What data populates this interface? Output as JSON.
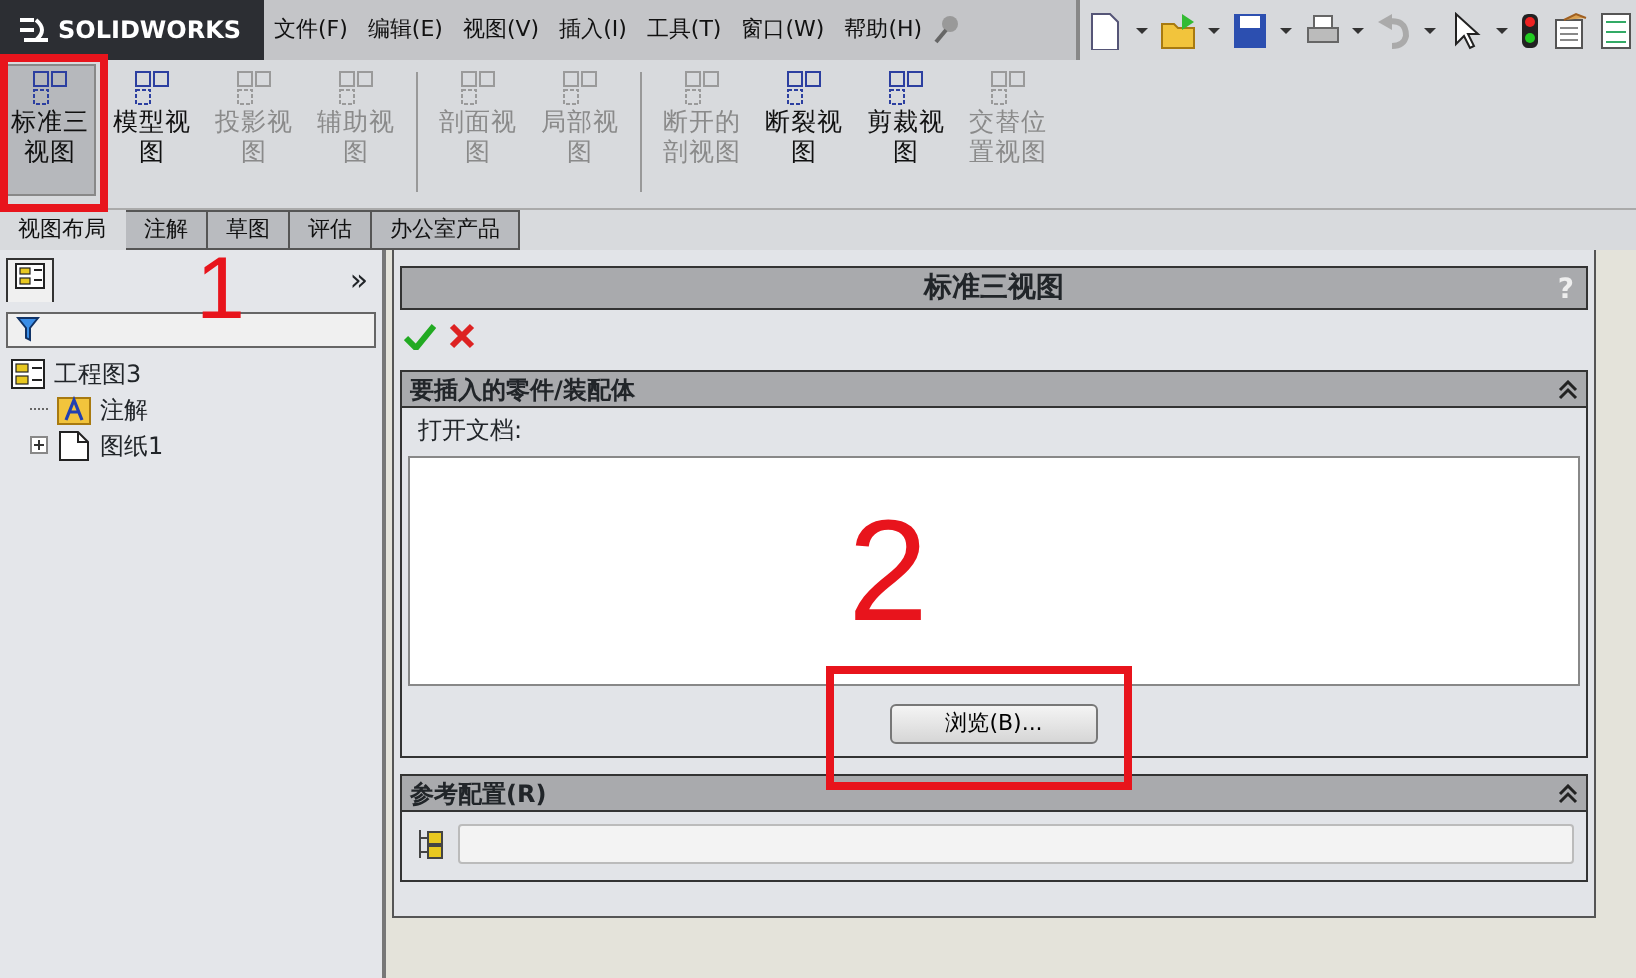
{
  "app": {
    "logo": "SOLIDWORKS"
  },
  "menu": [
    {
      "label": "文件(F)"
    },
    {
      "label": "编辑(E)"
    },
    {
      "label": "视图(V)"
    },
    {
      "label": "插入(I)"
    },
    {
      "label": "工具(T)"
    },
    {
      "label": "窗口(W)"
    },
    {
      "label": "帮助(H)"
    }
  ],
  "ribbon": [
    {
      "label": "标准三视图",
      "selected": true,
      "disabled": false
    },
    {
      "label": "模型视图",
      "selected": false,
      "disabled": false
    },
    {
      "label": "投影视图",
      "selected": false,
      "disabled": true
    },
    {
      "label": "辅助视图",
      "selected": false,
      "disabled": true,
      "separator_after": true
    },
    {
      "label": "剖面视图",
      "selected": false,
      "disabled": true
    },
    {
      "label": "局部视图",
      "selected": false,
      "disabled": true,
      "separator_after": true
    },
    {
      "label": "断开的剖视图",
      "selected": false,
      "disabled": true
    },
    {
      "label": "断裂视图",
      "selected": false,
      "disabled": false
    },
    {
      "label": "剪裁视图",
      "selected": false,
      "disabled": false
    },
    {
      "label": "交替位置视图",
      "selected": false,
      "disabled": true
    }
  ],
  "ribbon_tabs": [
    {
      "label": "视图布局",
      "selected": true
    },
    {
      "label": "注解",
      "selected": false
    },
    {
      "label": "草图",
      "selected": false
    },
    {
      "label": "评估",
      "selected": false
    },
    {
      "label": "办公室产品",
      "selected": false
    }
  ],
  "feature_tree": {
    "collapse": "»",
    "items": [
      {
        "label": "工程图3",
        "kind": "drawing",
        "children": [
          {
            "label": "注解",
            "kind": "annotations"
          },
          {
            "label": "图纸1",
            "kind": "sheet",
            "expanded": false
          }
        ]
      }
    ]
  },
  "property_manager": {
    "title": "标准三视图",
    "help": "?",
    "sections": [
      {
        "title": "要插入的零件/装配体",
        "kind": "open-document",
        "expanded": true,
        "label": "打开文档:",
        "button": "浏览(B)..."
      },
      {
        "title": "参考配置(R)",
        "kind": "configuration",
        "expanded": true
      }
    ]
  },
  "annotations": [
    {
      "text": "1"
    },
    {
      "text": "2"
    }
  ]
}
